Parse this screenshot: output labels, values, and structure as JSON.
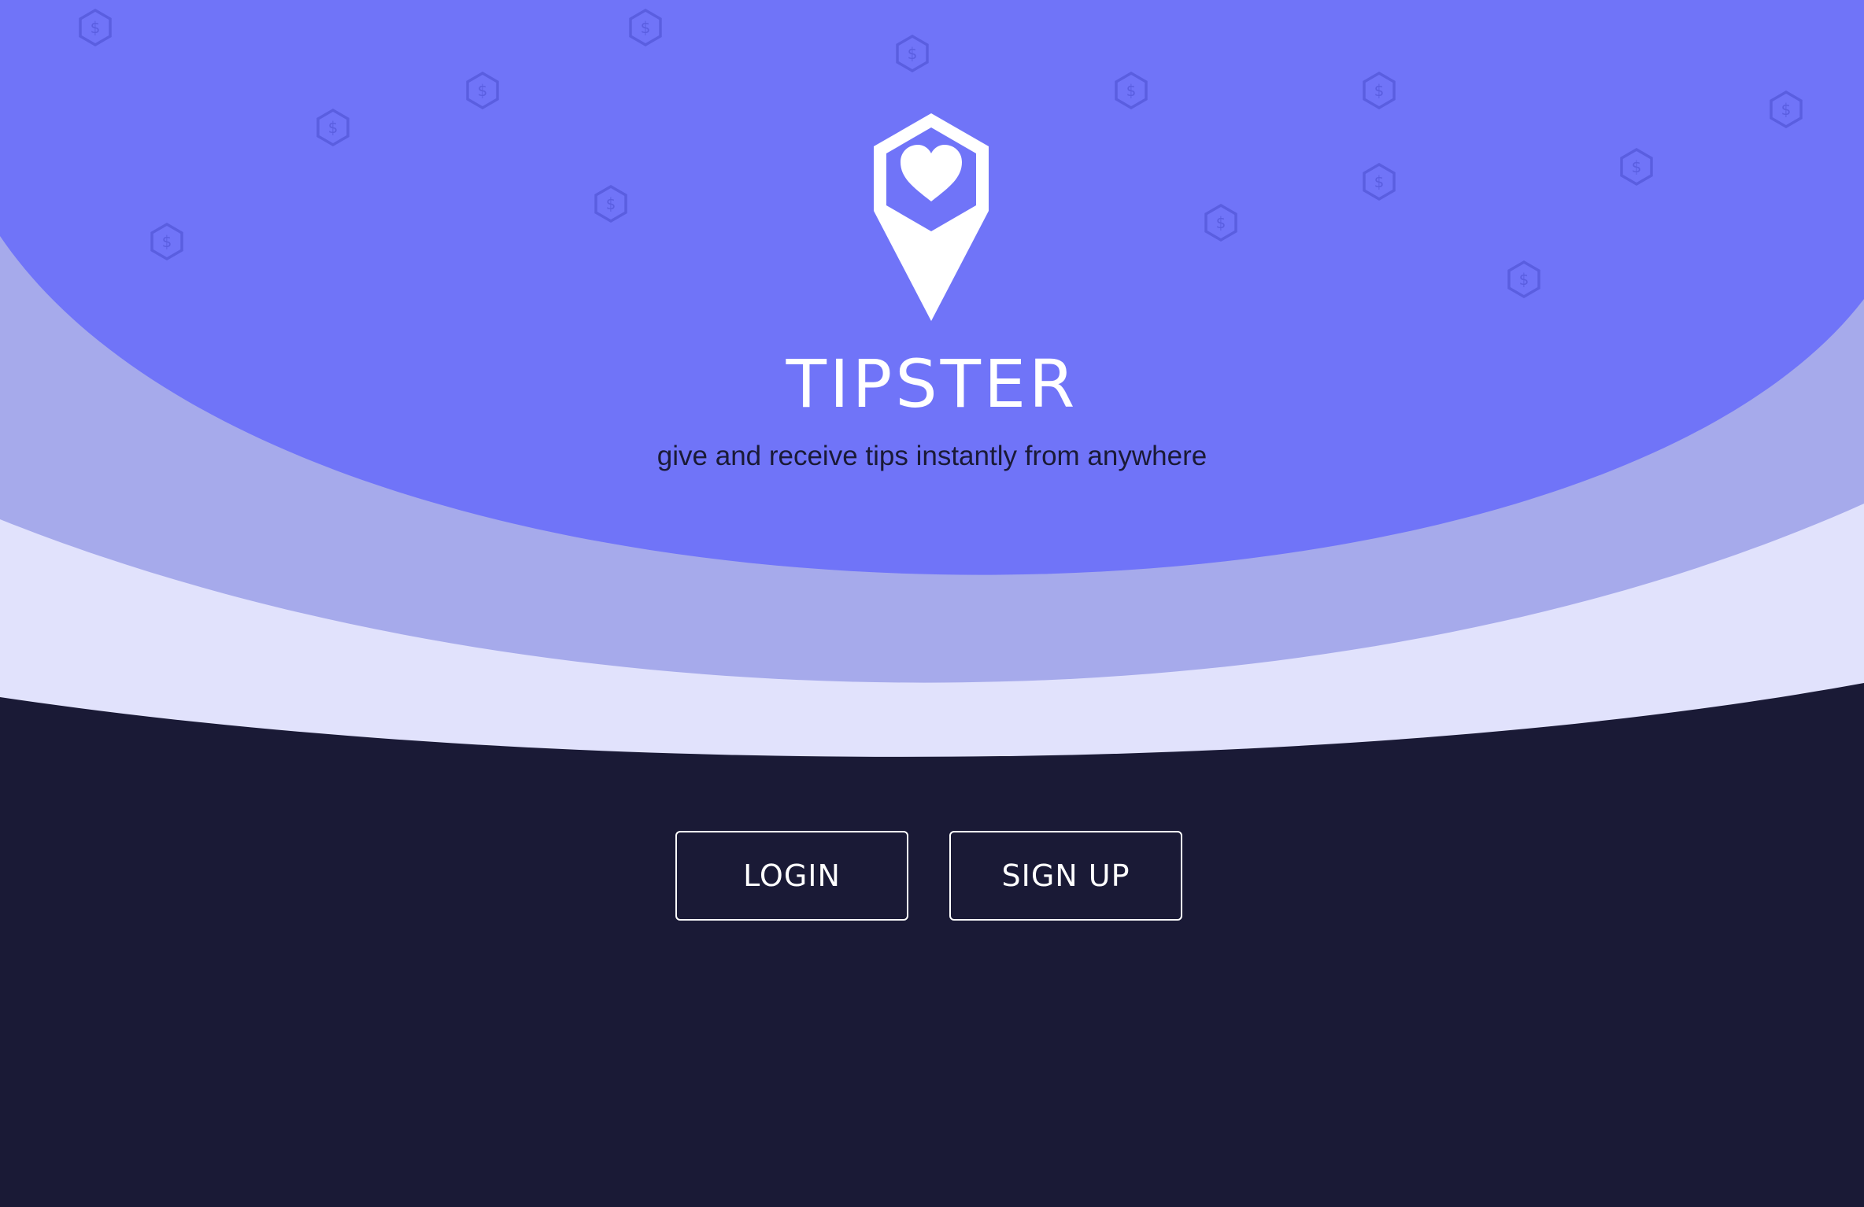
{
  "app": {
    "title": "TIPSTER",
    "tagline": "give and receive tips instantly from anywhere"
  },
  "actions": {
    "login_label": "LOGIN",
    "signup_label": "SIGN UP"
  },
  "icons": {
    "logo": "heart-location-pin-icon",
    "background_pattern": "dollar-hexagon-icon"
  },
  "colors": {
    "hero_primary": "#7074f8",
    "hero_mid": "#a6aaeb",
    "hero_light": "#e1e2fc",
    "base_dark": "#1a1a36",
    "text_light": "#ffffff"
  }
}
